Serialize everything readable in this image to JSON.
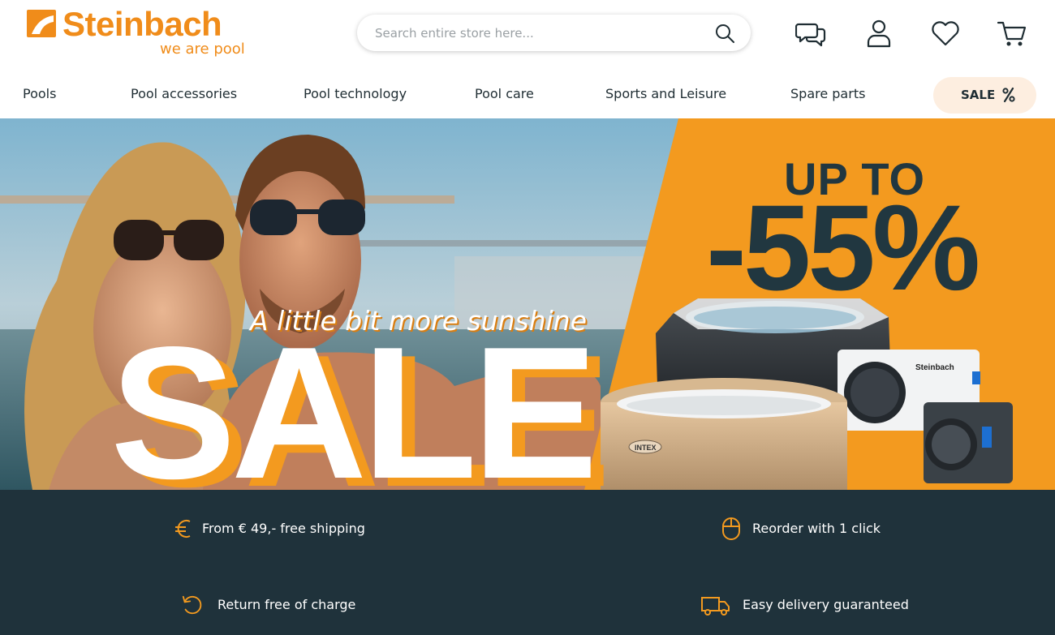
{
  "brand": {
    "name": "Steinbach",
    "tagline": "we are pool",
    "color": "#f08c1a"
  },
  "search": {
    "placeholder": "Search entire store here..."
  },
  "header_icons": [
    "chat-icon",
    "account-icon",
    "wishlist-heart-icon",
    "cart-icon"
  ],
  "nav": {
    "items": [
      "Pools",
      "Pool accessories",
      "Pool technology",
      "Pool care",
      "Sports and Leisure",
      "Spare parts"
    ],
    "sale_label": "SALE",
    "sale_icon": "percent-icon"
  },
  "banner": {
    "headline_top": "UP TO",
    "headline_discount": "-55%",
    "tagline": "A little bit more sunshine",
    "sale_word": "SALE",
    "product_labels": [
      "Steinbach",
      "INTEX",
      "INTEX"
    ],
    "accent_color": "#f39a1f",
    "dark_color": "#213740"
  },
  "benefits": [
    {
      "icon": "euro-icon",
      "text": "From € 49,- free shipping"
    },
    {
      "icon": "mouse-icon",
      "text": "Reorder with 1 click"
    },
    {
      "icon": "return-arrow-icon",
      "text": "Return free of charge"
    },
    {
      "icon": "delivery-truck-icon",
      "text": "Easy delivery guaranteed"
    }
  ],
  "colors": {
    "benefit_bar": "#1f323b",
    "sale_pill_bg": "#fdeee0",
    "text_dark": "#1f2d33"
  }
}
